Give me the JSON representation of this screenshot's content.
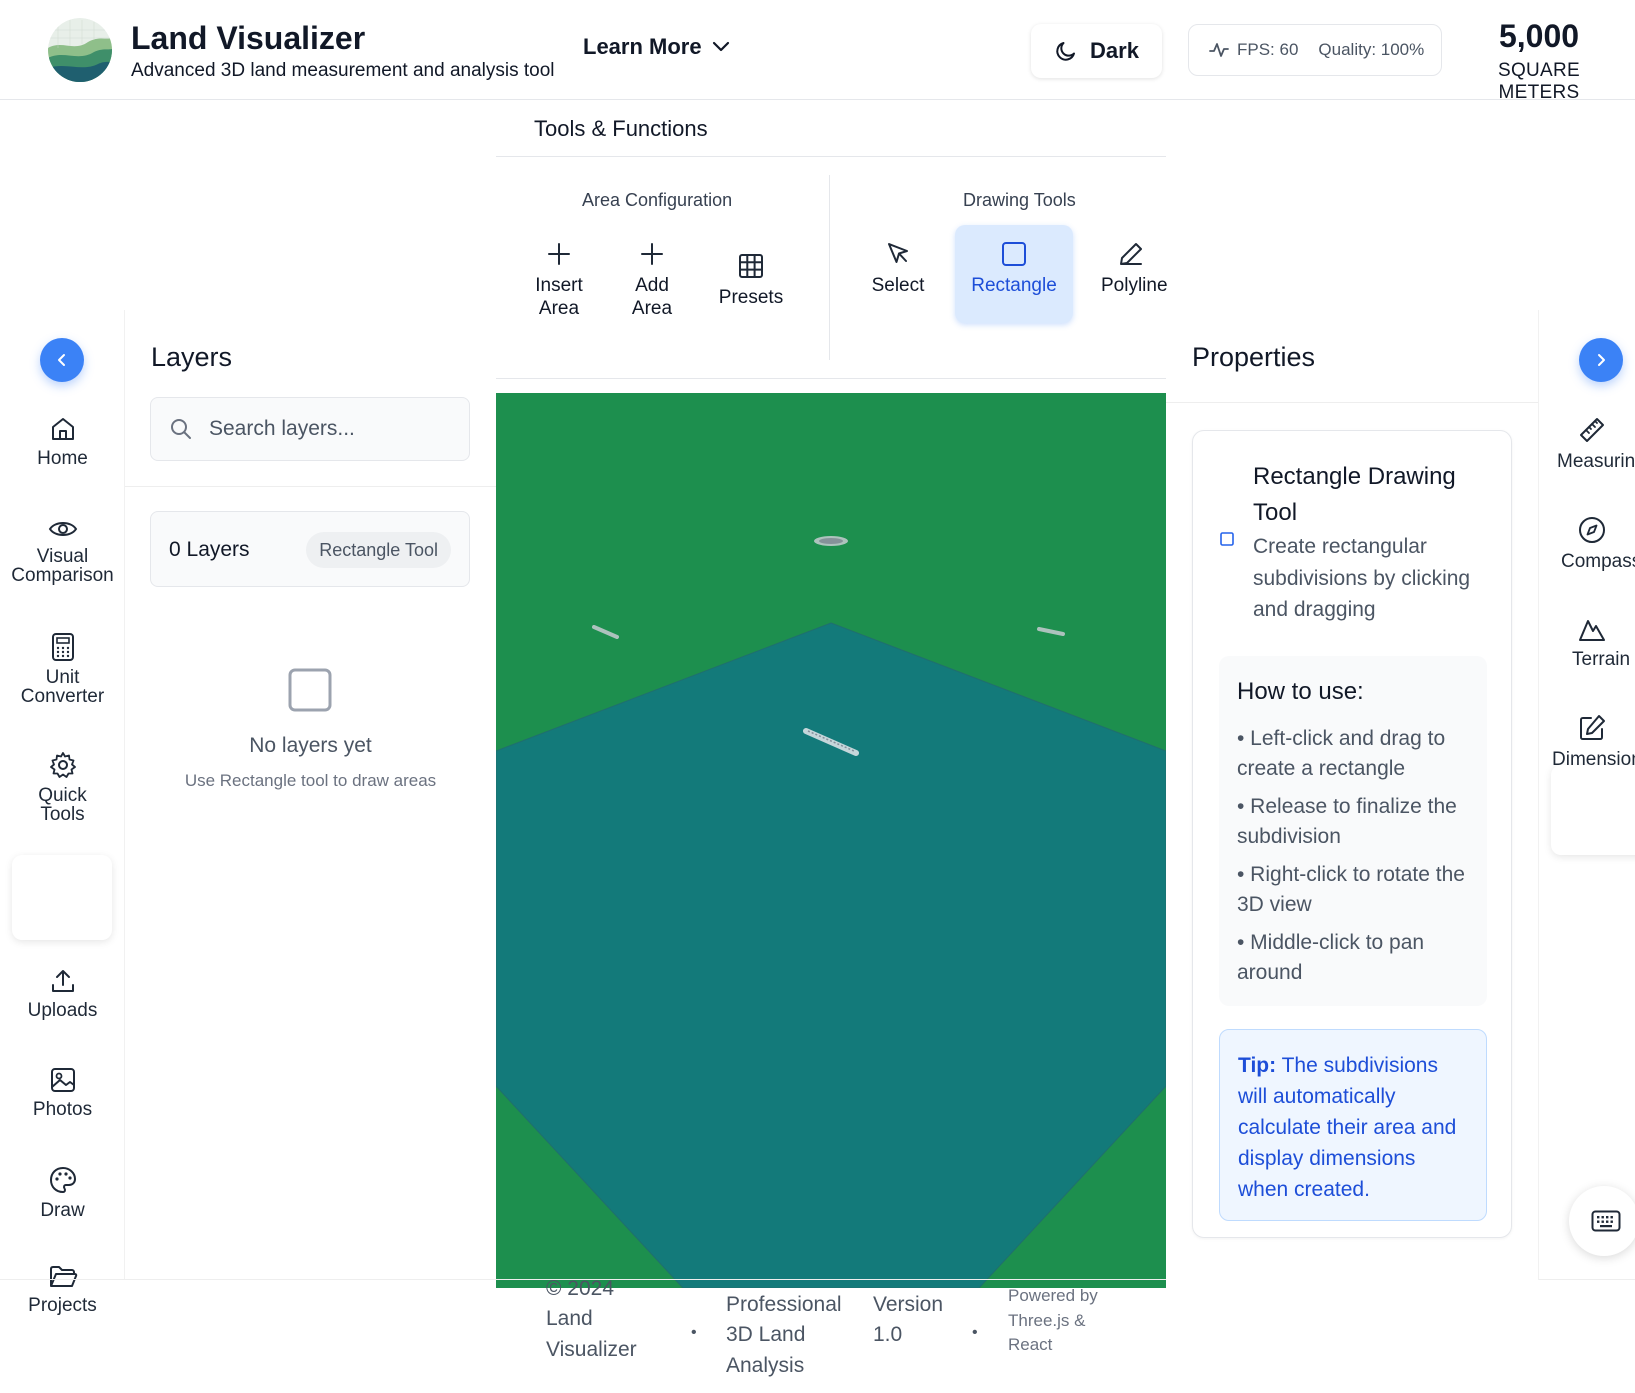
{
  "header": {
    "title": "Land Visualizer",
    "subtitle": "Advanced 3D land measurement and analysis tool",
    "learn_more": "Learn More",
    "theme_toggle": "Dark",
    "fps": "FPS: 60",
    "quality": "Quality: 100%",
    "area_value": "5,000",
    "area_unit": "SQUARE METERS"
  },
  "toolbar": {
    "title": "Tools & Functions",
    "groups": [
      {
        "title": "Area Configuration",
        "tools": [
          {
            "label": "Insert Area",
            "icon": "plus-icon"
          },
          {
            "label": "Add Area",
            "icon": "plus-icon"
          },
          {
            "label": "Presets",
            "icon": "grid-icon"
          }
        ]
      },
      {
        "title": "Drawing Tools",
        "tools": [
          {
            "label": "Select",
            "icon": "cursor-icon"
          },
          {
            "label": "Rectangle",
            "icon": "square-icon",
            "active": true
          },
          {
            "label": "Polyline",
            "icon": "pencil-icon"
          }
        ]
      }
    ]
  },
  "left_nav": {
    "items": [
      {
        "label": "Home",
        "icon": "home-icon"
      },
      {
        "label": "Visual Comparison",
        "icon": "eye-icon"
      },
      {
        "label": "Unit Converter",
        "icon": "calculator-icon"
      },
      {
        "label": "Quick Tools",
        "icon": "gear-icon"
      },
      {
        "label": "Uploads",
        "icon": "upload-icon"
      },
      {
        "label": "Photos",
        "icon": "image-icon"
      },
      {
        "label": "Draw",
        "icon": "palette-icon"
      },
      {
        "label": "Projects",
        "icon": "folder-icon"
      }
    ]
  },
  "layers": {
    "title": "Layers",
    "search_placeholder": "Search layers...",
    "count": "0 Layers",
    "active_tool": "Rectangle Tool",
    "empty_title": "No layers yet",
    "empty_sub": "Use Rectangle tool to draw areas"
  },
  "properties": {
    "title": "Properties",
    "tool_title": "Rectangle Drawing Tool",
    "tool_desc": "Create rectangular subdivisions by clicking and dragging",
    "howto_title": "How to use:",
    "howto_items": [
      "• Left-click and drag to create a rectangle",
      "• Release to finalize the subdivision",
      "• Right-click to rotate the 3D view",
      "• Middle-click to pan around"
    ],
    "tip_label": "Tip:",
    "tip_text": "The subdivisions will automatically calculate their area and display dimensions when created."
  },
  "right_nav": {
    "items": [
      {
        "label": "Measuring",
        "icon": "ruler-icon"
      },
      {
        "label": "Compass",
        "icon": "compass-icon"
      },
      {
        "label": "Terrain",
        "icon": "mountain-icon"
      },
      {
        "label": "Dimensions",
        "icon": "edit-icon"
      }
    ]
  },
  "footer": {
    "copyright": "© 2024 Land Visualizer",
    "tagline": "Professional 3D Land Analysis",
    "version": "Version 1.0",
    "powered": "Powered by Three.js & React"
  },
  "colors": {
    "accent": "#3b82f6",
    "grass": "#1d8f4e",
    "land": "#137a7a"
  }
}
